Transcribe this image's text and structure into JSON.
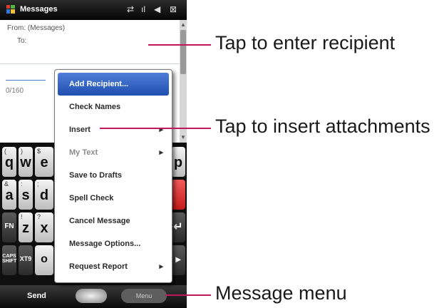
{
  "status_bar": {
    "title": "Messages",
    "sync_indicator": "⇄",
    "signal_indicator": "ıl",
    "volume_indicator": "◀",
    "close_label": "⊠"
  },
  "compose": {
    "from_label": "From: (Messages)",
    "to_label": "To:",
    "char_counter": "0/160"
  },
  "menu": {
    "items": [
      {
        "label": "Add Recipient...",
        "state": "selected",
        "submenu": false
      },
      {
        "label": "Check Names",
        "state": "normal",
        "submenu": false
      },
      {
        "label": "Insert",
        "state": "normal",
        "submenu": true
      },
      {
        "label": "My Text",
        "state": "disabled",
        "submenu": true
      },
      {
        "label": "Save to Drafts",
        "state": "normal",
        "submenu": false
      },
      {
        "label": "Spell Check",
        "state": "normal",
        "submenu": false
      },
      {
        "label": "Cancel Message",
        "state": "normal",
        "submenu": false
      },
      {
        "label": "Message Options...",
        "state": "normal",
        "submenu": false
      },
      {
        "label": "Request Report",
        "state": "normal",
        "submenu": true
      }
    ],
    "submenu_glyph": "▸"
  },
  "keyboard": {
    "row1": [
      {
        "main": "q",
        "sub": "("
      },
      {
        "main": "w",
        "sub": ")"
      },
      {
        "main": "e",
        "sub": "$"
      },
      {
        "main": "p",
        "sub": ""
      }
    ],
    "row2": [
      {
        "main": "a",
        "sub": "&"
      },
      {
        "main": "s",
        "sub": ":"
      },
      {
        "main": "d",
        "sub": ";"
      }
    ],
    "row3": [
      {
        "main": "z",
        "sub": "!"
      },
      {
        "main": "x",
        "sub": "?"
      }
    ],
    "row4_partial": "o",
    "fn_label": "FN",
    "caps_label": "CAPS SHIFT",
    "xt9_label": "XT9",
    "enter_glyph": "↵",
    "right_glyph": "▸"
  },
  "softkeys": {
    "left": "Send",
    "right": "Menu"
  },
  "annotations": {
    "recipient": "Tap to enter recipient",
    "attachments": "Tap to insert attachments",
    "menu": "Message menu"
  },
  "colors": {
    "menu_highlight": "#2a5bbf",
    "callout_line": "#c2185b",
    "red_key": "#d62b2b"
  }
}
